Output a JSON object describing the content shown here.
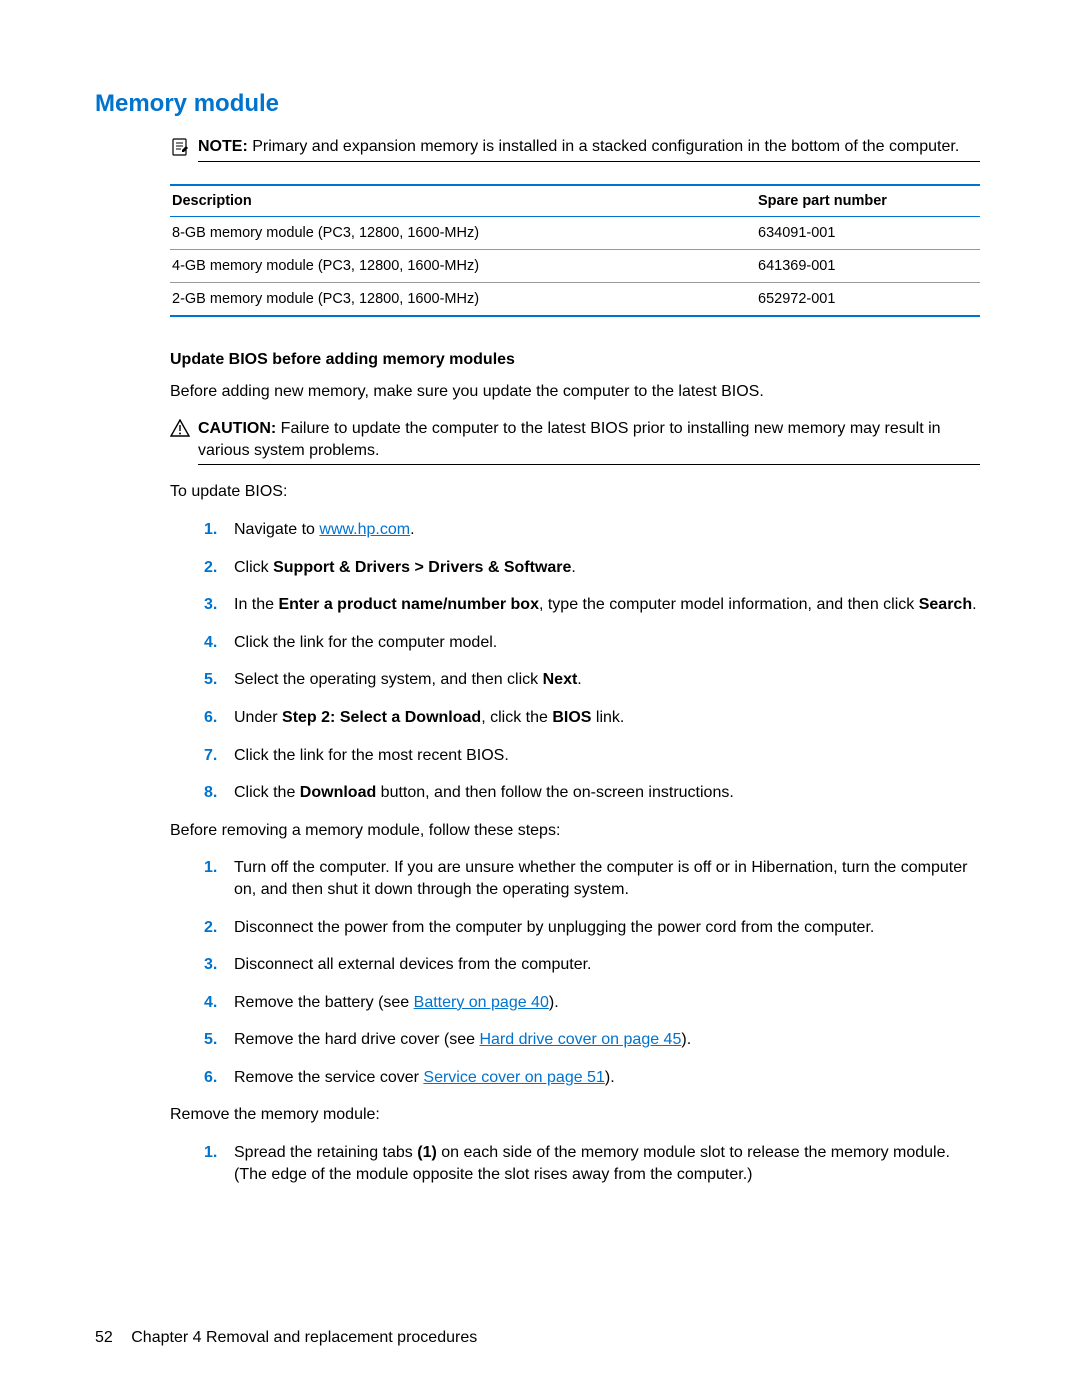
{
  "section_title": "Memory module",
  "note": {
    "label": "NOTE:",
    "text": "Primary and expansion memory is installed in a stacked configuration in the bottom of the computer."
  },
  "table": {
    "headers": {
      "desc": "Description",
      "spn": "Spare part number"
    },
    "rows": [
      {
        "desc": "8-GB memory module (PC3, 12800, 1600-MHz)",
        "spn": "634091-001"
      },
      {
        "desc": "4-GB memory module (PC3, 12800, 1600-MHz)",
        "spn": "641369-001"
      },
      {
        "desc": "2-GB memory module (PC3, 12800, 1600-MHz)",
        "spn": "652972-001"
      }
    ]
  },
  "sub_heading": "Update BIOS before adding memory modules",
  "intro": "Before adding new memory, make sure you update the computer to the latest BIOS.",
  "caution": {
    "label": "CAUTION:",
    "text": "Failure to update the computer to the latest BIOS prior to installing new memory may result in various system problems."
  },
  "to_update": "To update BIOS:",
  "steps_bios": {
    "s1_pre": "Navigate to ",
    "s1_link": "www.hp.com",
    "s1_post": ".",
    "s2_pre": "Click ",
    "s2_bold": "Support & Drivers > Drivers & Software",
    "s2_post": ".",
    "s3_pre": "In the ",
    "s3_bold1": "Enter a product name/number box",
    "s3_mid": ", type the computer model information, and then click ",
    "s3_bold2": "Search",
    "s3_post": ".",
    "s4": "Click the link for the computer model.",
    "s5_pre": "Select the operating system, and then click ",
    "s5_bold": "Next",
    "s5_post": ".",
    "s6_pre": "Under ",
    "s6_bold1": "Step 2: Select a Download",
    "s6_mid": ", click the ",
    "s6_bold2": "BIOS",
    "s6_post": " link.",
    "s7": "Click the link for the most recent BIOS.",
    "s8_pre": "Click the ",
    "s8_bold": "Download",
    "s8_post": " button, and then follow the on-screen instructions."
  },
  "before_remove": "Before removing a memory module, follow these steps:",
  "steps_remove": {
    "s1": "Turn off the computer. If you are unsure whether the computer is off or in Hibernation, turn the computer on, and then shut it down through the operating system.",
    "s2": "Disconnect the power from the computer by unplugging the power cord from the computer.",
    "s3": "Disconnect all external devices from the computer.",
    "s4_pre": "Remove the battery (see ",
    "s4_link": "Battery on page 40",
    "s4_post": ").",
    "s5_pre": "Remove the hard drive cover (see ",
    "s5_link": "Hard drive cover on page 45",
    "s5_post": ").",
    "s6_pre": "Remove the service cover ",
    "s6_link": "Service cover on page 51",
    "s6_post": ")."
  },
  "remove_mm": "Remove the memory module:",
  "steps_mm": {
    "s1_pre": "Spread the retaining tabs ",
    "s1_bold": "(1)",
    "s1_post": " on each side of the memory module slot to release the memory module. (The edge of the module opposite the slot rises away from the computer.)"
  },
  "footer": {
    "page": "52",
    "chapter": "Chapter 4   Removal and replacement procedures"
  }
}
